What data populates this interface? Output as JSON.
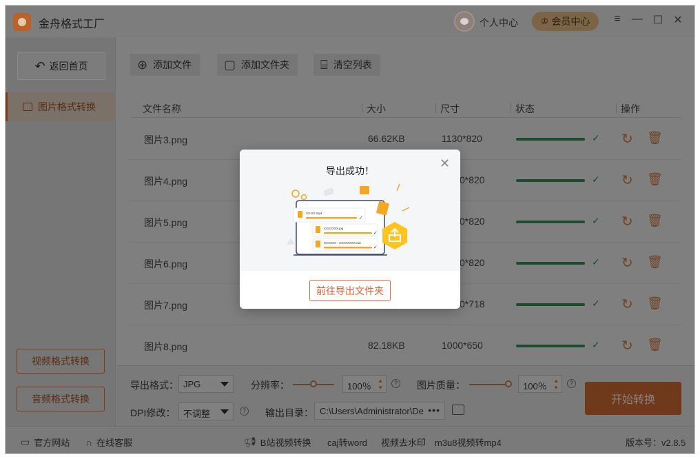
{
  "app": {
    "title": "金舟格式工厂"
  },
  "titlebar": {
    "user_center": "个人中心",
    "vip_center": "会员中心",
    "menu_icon": "≡",
    "minimize_icon": "—",
    "maximize_icon": "☐",
    "close_icon": "✕"
  },
  "sidebar": {
    "home": "返回首页",
    "active_item": "图片格式转换",
    "video_convert": "视频格式转换",
    "audio_convert": "音频格式转换"
  },
  "toolbar": {
    "add_file": "添加文件",
    "add_folder": "添加文件夹",
    "clear_list": "清空列表"
  },
  "table": {
    "headers": {
      "name": "文件名称",
      "size": "大小",
      "dims": "尺寸",
      "status": "状态",
      "ops": "操作"
    },
    "rows": [
      {
        "name": "图片3.png",
        "size": "66.62KB",
        "dims": "1130*820",
        "progress": 1.0
      },
      {
        "name": "图片4.png",
        "size": "",
        "dims": "0*820",
        "progress": 1.0
      },
      {
        "name": "图片5.png",
        "size": "",
        "dims": "0*820",
        "progress": 1.0
      },
      {
        "name": "图片6.png",
        "size": "",
        "dims": "0*820",
        "progress": 1.0
      },
      {
        "name": "图片7.png",
        "size": "",
        "dims": "0*718",
        "progress": 1.0
      },
      {
        "name": "图片8.png",
        "size": "82.18KB",
        "dims": "1000*650",
        "progress": 1.0
      }
    ]
  },
  "settings": {
    "format_label": "导出格式：",
    "format_value": "JPG",
    "resolution_label": "分辨率：",
    "resolution_value": "100％",
    "quality_label": "图片质量：",
    "quality_value": "100％",
    "dpi_label": "DPI修改：",
    "dpi_value": "不调整",
    "output_label": "输出目录：",
    "output_path": "C:\\Users\\Administrator\\De",
    "output_more": "•••",
    "start_button": "开始转换"
  },
  "footer": {
    "website": "官方网站",
    "support": "在线客服",
    "link1": "B站视频转换",
    "link2": "caj转word",
    "link3": "视频去水印",
    "link4": "m3u8视频转mp4",
    "version": "版本号：v2.8.5"
  },
  "modal": {
    "title": "导出成功！",
    "goto_button": "前往导出文件夹",
    "illus_file1": "XX-XX.mp4",
    "illus_file2": "XXXXXXX.jpg",
    "illus_file3": "XXXXXX - XXXXXXXX.doc"
  },
  "colors": {
    "accent": "#e0602f",
    "success": "#1f9a4a"
  }
}
